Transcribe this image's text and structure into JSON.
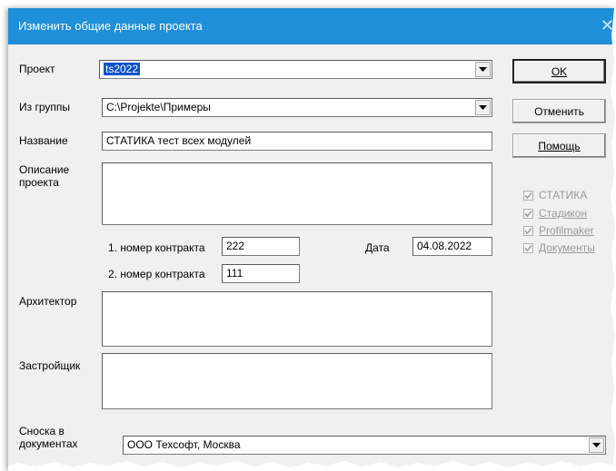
{
  "window": {
    "title": "Изменить общие данные проекта"
  },
  "fields": {
    "project": {
      "label": "Проект",
      "value": "ts2022"
    },
    "group": {
      "label": "Из группы",
      "value": "C:\\Projekte\\Примеры"
    },
    "name": {
      "label": "Название",
      "value": "СТАТИКА тест всех модулей"
    },
    "description": {
      "label_line1": "Описание",
      "label_line2": "проекта",
      "value": ""
    },
    "contract1": {
      "label": "1. номер контракта",
      "value": "222"
    },
    "date": {
      "label": "Дата",
      "value": "04.08.2022"
    },
    "contract2": {
      "label": "2. номер контракта",
      "value": "111"
    },
    "architect": {
      "label": "Архитектор",
      "value": ""
    },
    "developer": {
      "label": "Застройщик",
      "value": ""
    },
    "footnote": {
      "label_line1": "Сноска в",
      "label_line2": "документах",
      "value": "ООО Техсофт, Москва"
    }
  },
  "buttons": {
    "ok": "OK",
    "cancel": "Отменить",
    "help": "Помощь"
  },
  "modules": [
    {
      "label": "СТАТИКА",
      "checked": true
    },
    {
      "label": "Стадикон",
      "checked": true
    },
    {
      "label": "Profilmaker",
      "checked": true
    },
    {
      "label": "Документы",
      "checked": true
    }
  ],
  "colors": {
    "titlebar": "#1e8fd8",
    "selection": "#0a52c7",
    "dialog_bg": "#f0f0f0"
  }
}
